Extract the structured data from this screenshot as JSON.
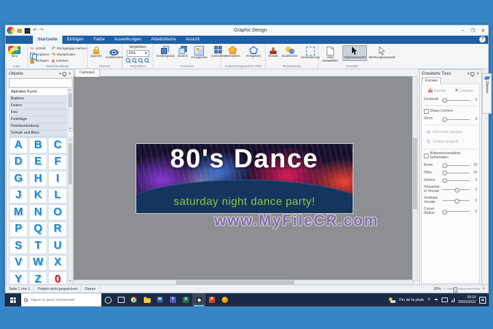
{
  "titlebar": {
    "title": "Graphic Design",
    "minimize": "–",
    "maximize": "❐",
    "close": "✕"
  },
  "menu_tabs": [
    "Startseite",
    "Einfügen",
    "Farbe",
    "Auswirkungen",
    "Arbeitsfläche",
    "Ansicht"
  ],
  "help_label": "?",
  "icons": {
    "scissors": "✂",
    "undo": "↶",
    "redo": "↷",
    "delete_x": "×",
    "dropdown": "▾",
    "close": "✕",
    "up_arrow": "▲",
    "down_arrow": "▼",
    "chevron_up": "∧",
    "cloud": "☁",
    "minus": "−",
    "plus": "+",
    "mirror_h": "⇄",
    "mirror_v": "⇅",
    "new_badge": "NEW"
  },
  "ribbon": {
    "logo": {
      "label": "Logo",
      "button": "Neu"
    },
    "clipboard": {
      "label": "Zwischenablage",
      "cut": "Schnitt",
      "copy": "Kopieren",
      "paste": "Einfügen",
      "undo": "Rückgängig machen",
      "redo": "Wiederholen",
      "delete": "Löschen"
    },
    "layers": {
      "label": "Ebenen",
      "lock": "Sperren",
      "hide": "Ausblenden"
    },
    "zoom": {
      "label": "Vergrößern",
      "title": "Vergrößern",
      "value": "20%"
    },
    "arrange": {
      "label": "Anordnen",
      "front": "Vordergrund",
      "back": "Zurück",
      "group": "Gruppieren",
      "align": "Ausrichten"
    },
    "compound_path": {
      "label": "Zusammengesetzter Pfad",
      "make": "Herstellen",
      "release": "Freigeben"
    },
    "editing": {
      "label": "Bearbeitung",
      "clone": "Klonen",
      "boolean": "Boolesche",
      "transform": "Veränderung"
    },
    "selection": {
      "label": "Auswahl",
      "select_all": "Alles auswählen",
      "object_select": "Objektauswahl",
      "direction_select": "Richtungsauswahl"
    }
  },
  "objects_panel": {
    "title": "Objekte",
    "categories": [
      "Alphabet Kunst",
      "Buttons",
      "Feiern",
      "Frei",
      "Feiertage",
      "Fotobearbeitung",
      "Schule und Büro"
    ],
    "selected_category": "Alphabet Kunst",
    "letters": [
      "A",
      "B",
      "C",
      "D",
      "E",
      "F",
      "G",
      "H",
      "I",
      "J",
      "K",
      "L",
      "M",
      "N",
      "O",
      "P",
      "Q",
      "R",
      "S",
      "T",
      "U",
      "V",
      "W",
      "X",
      "Y",
      "Z",
      "0"
    ]
  },
  "canvas": {
    "tab": "Canvas1",
    "banner": {
      "title": "80's Dance",
      "subtitle": "saturday night dance party!"
    },
    "watermark": "www.MyFileCR.com"
  },
  "tools_panel": {
    "title": "Erweiterte Tools",
    "tab": "Formen",
    "clone": "Klonen",
    "delete": "Löschen",
    "mirror_horizontal": "Horizontal spiegeln",
    "mirror_vertical": "Vertikal spiegeln",
    "checkbox_sharp": "Sharp Corners",
    "checkbox_aspect": "Bildseitenverhältnis beibehalten",
    "sliders": [
      {
        "label": "Deckkraft",
        "value": "0",
        "position": "left"
      },
      {
        "label": "Strich",
        "value": "0",
        "position": "left"
      },
      {
        "label": "Breite",
        "value": "10",
        "position": "left"
      },
      {
        "label": "Höhe",
        "value": "10",
        "position": "left"
      },
      {
        "label": "Drehen",
        "value": "0",
        "position": "left"
      },
      {
        "label": "Horizontaler Versatz",
        "value": "0",
        "position": "center"
      },
      {
        "label": "Vertikaler Versatz",
        "value": "0",
        "position": "center"
      },
      {
        "label": "Corner Radius",
        "value": "0",
        "position": "left"
      }
    ]
  },
  "layers_flyout_tab": "Ebenen",
  "status_bar": {
    "page": "Seite 1 von 1",
    "saved": "Projekt nicht gespeichert",
    "date_label": "Datum",
    "zoom": "20%"
  },
  "taskbar": {
    "search_placeholder": "Taper ici pour rechercher",
    "weather": "Fin de la pluie",
    "time": "18:10",
    "date": "30/03/2022",
    "word_initial": "W",
    "teams_initial": "T",
    "excel_initial": "X",
    "powerpoint_initial": "P"
  }
}
